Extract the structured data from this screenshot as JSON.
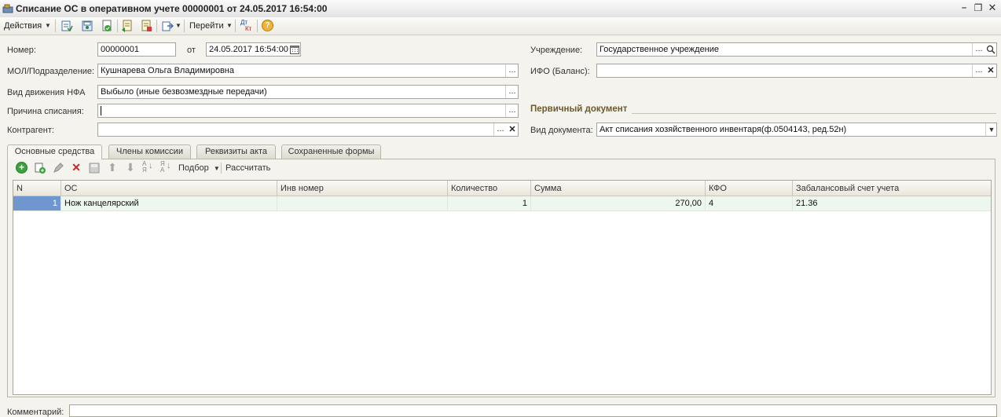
{
  "window": {
    "title": "Списание ОС в оперативном учете 00000001 от 24.05.2017 16:54:00"
  },
  "toolbar": {
    "actions_label": "Действия",
    "goto_label": "Перейти"
  },
  "form": {
    "number_label": "Номер:",
    "number_value": "00000001",
    "from_label": "от",
    "date_value": "24.05.2017 16:54:00",
    "mol_label": "МОЛ/Подразделение:",
    "mol_value": "Кушнарева Ольга Владимировна",
    "movement_label": "Вид движения НФА",
    "movement_value": "Выбыло (иные безвозмездные передачи)",
    "reason_label": "Причина списания:",
    "reason_value": "",
    "counterparty_label": "Контрагент:",
    "counterparty_value": "",
    "institution_label": "Учреждение:",
    "institution_value": "Государственное учреждение",
    "ifo_label": "ИФО (Баланс):",
    "ifo_value": "",
    "primary_doc_title": "Первичный документ",
    "doc_type_label": "Вид документа:",
    "doc_type_value": "Акт списания хозяйственного инвентаря(ф.0504143, ред.52н)",
    "comment_label": "Комментарий:",
    "comment_value": ""
  },
  "tabs": [
    "Основные средства",
    "Члены комиссии",
    "Реквизиты акта",
    "Сохраненные формы"
  ],
  "table_toolbar": {
    "pick_label": "Подбор",
    "calc_label": "Рассчитать"
  },
  "table": {
    "columns": [
      "N",
      "ОС",
      "Инв номер",
      "Количество",
      "Сумма",
      "КФО",
      "Забалансовый счет учета"
    ],
    "rows": [
      [
        "1",
        "Нож канцелярский",
        "",
        "1",
        "270,00",
        "4",
        "21.36"
      ]
    ]
  }
}
